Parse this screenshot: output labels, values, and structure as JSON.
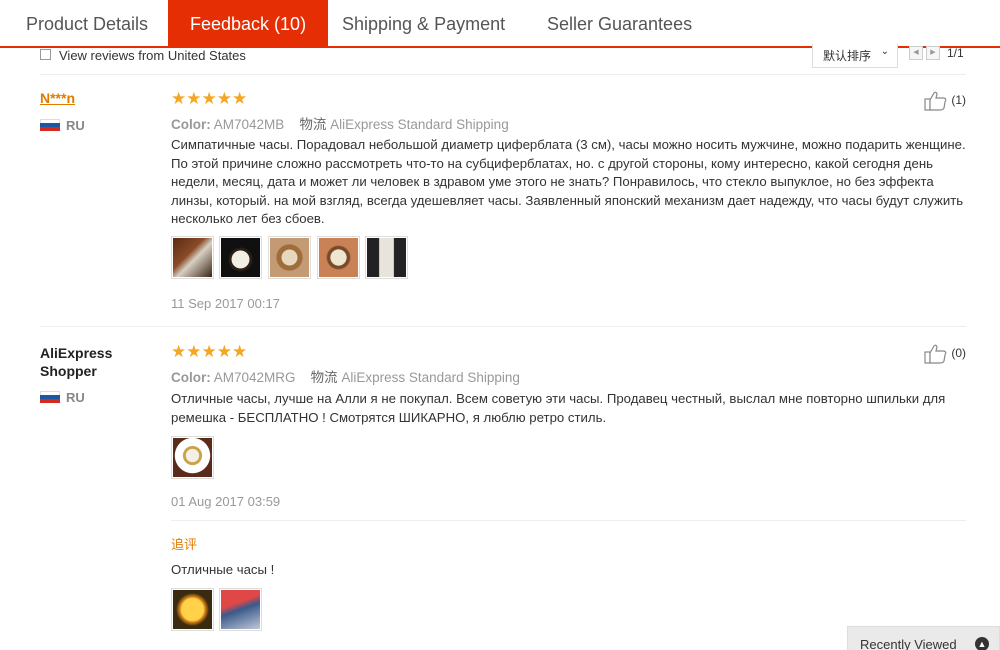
{
  "tabs": [
    {
      "label": "Product Details",
      "active": false
    },
    {
      "label": "Feedback (10)",
      "active": true
    },
    {
      "label": "Shipping & Payment",
      "active": false
    },
    {
      "label": "Seller Guarantees",
      "active": false
    }
  ],
  "filter": {
    "checkbox_label": "View reviews from United States",
    "checked": false,
    "sort_label": "默认排序",
    "page_info": "1/1"
  },
  "colors": {
    "accent": "#e62e04",
    "star": "#f5a623",
    "link": "#e07b00"
  },
  "reviews": [
    {
      "reviewer": "N***n",
      "country": "RU",
      "stars": "★★★★★",
      "color_label": "Color:",
      "color_value": "AM7042MB",
      "shipping_label": "物流",
      "shipping_value": "AliExpress Standard Shipping",
      "text": "Симпатичные часы. Порадовал небольшой диаметр циферблата (3 см), часы можно носить мужчине, можно подарить женщине. По этой причине сложно рассмотреть что-то на субциферблатах, но. с другой стороны, кому интересно, какой сегодня день недели, месяц, дата и может ли человек в здравом уме этого не знать? Понравилось, что стекло выпуклое, но без эффекта линзы, который. на мой взгляд, всегда удешевляет часы. Заявленный японский механизм дает надежду, что часы будут служить несколько лет без сбоев.",
      "date": "11 Sep 2017 00:17",
      "likes": "(1)",
      "photos": 5
    },
    {
      "reviewer": "AliExpress Shopper",
      "country": "RU",
      "stars": "★★★★★",
      "color_label": "Color:",
      "color_value": "AM7042MRG",
      "shipping_label": "物流",
      "shipping_value": "AliExpress Standard Shipping",
      "text": "Отличные часы, лучше на Алли я не покупал. Всем советую эти часы. Продавец честный, выслал мне повторно шпильки для ремешка - БЕСПЛАТНО ! Смотрятся ШИКАРНО, я люблю ретро стиль.",
      "date": "01 Aug 2017 03:59",
      "likes": "(0)",
      "photos": 1,
      "followup_label": "追评",
      "followup_text": "Отличные часы !",
      "followup_photos": 2
    }
  ],
  "recently_viewed": "Recently Viewed"
}
